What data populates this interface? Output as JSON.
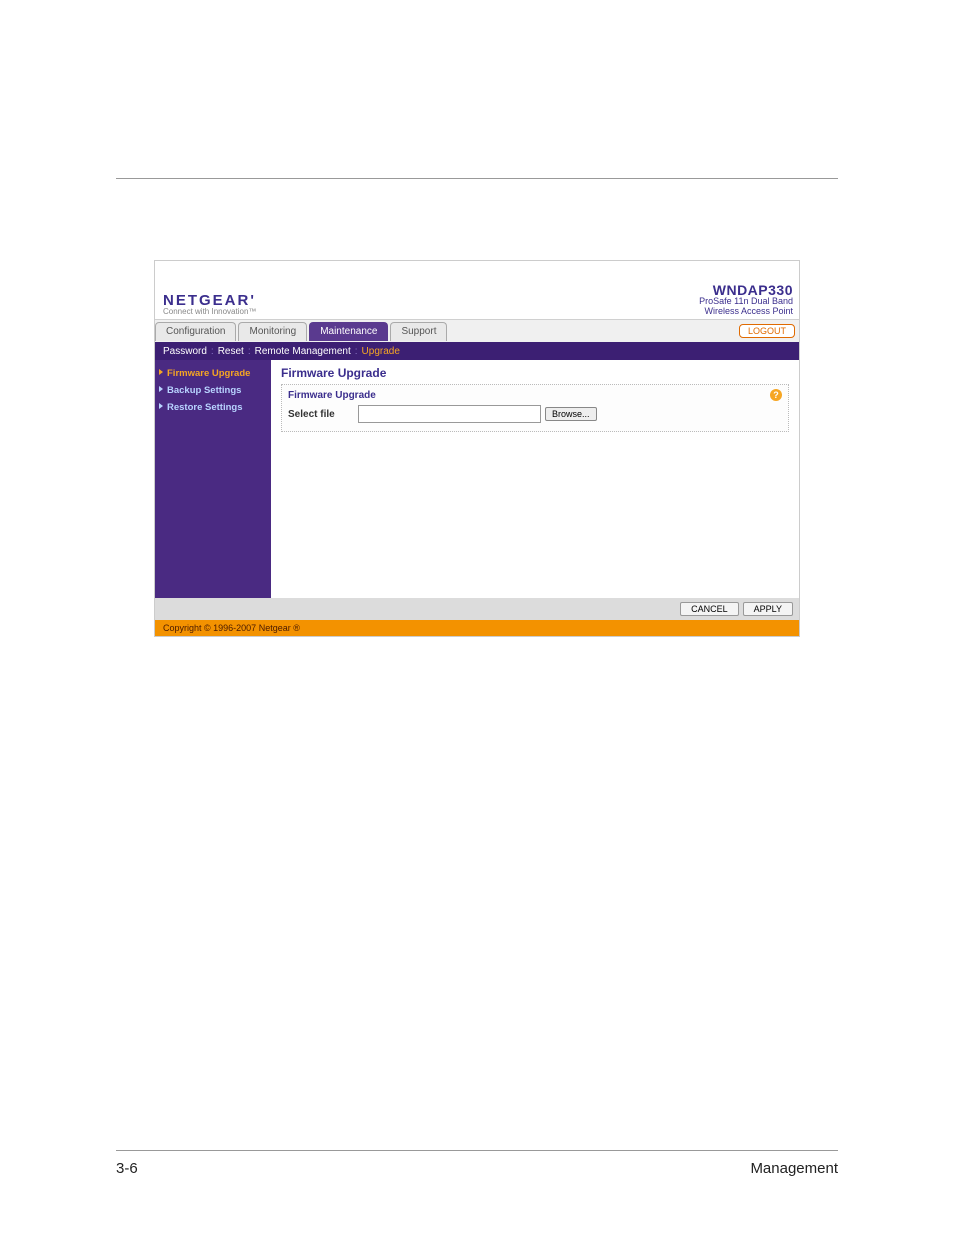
{
  "brand": {
    "name": "NETGEAR'",
    "tagline": "Connect with Innovation™"
  },
  "product": {
    "name": "WNDAP330",
    "line1": "ProSafe 11n Dual Band",
    "line2": "Wireless Access Point"
  },
  "logout_label": "LOGOUT",
  "tabs": [
    {
      "label": "Configuration",
      "active": false
    },
    {
      "label": "Monitoring",
      "active": false
    },
    {
      "label": "Maintenance",
      "active": true
    },
    {
      "label": "Support",
      "active": false
    }
  ],
  "subnav": [
    {
      "label": "Password",
      "active": false
    },
    {
      "label": "Reset",
      "active": false
    },
    {
      "label": "Remote Management",
      "active": false
    },
    {
      "label": "Upgrade",
      "active": true
    }
  ],
  "sidenav": [
    {
      "label": "Firmware Upgrade",
      "active": true
    },
    {
      "label": "Backup Settings",
      "active": false
    },
    {
      "label": "Restore Settings",
      "active": false
    }
  ],
  "content": {
    "section_title": "Firmware Upgrade",
    "form_title": "Firmware Upgrade",
    "select_file_label": "Select file",
    "file_value": "",
    "browse_label": "Browse..."
  },
  "actions": {
    "cancel": "CANCEL",
    "apply": "APPLY"
  },
  "copyright": "Copyright © 1996-2007 Netgear ®",
  "footer": {
    "page": "3-6",
    "section": "Management"
  }
}
